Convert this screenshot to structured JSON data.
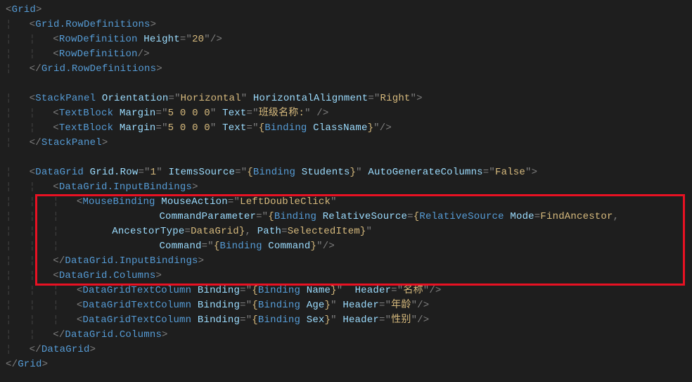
{
  "lines": {
    "l1": {
      "g": "",
      "tokens": [
        {
          "c": "br",
          "t": "<"
        },
        {
          "c": "el",
          "t": "Grid"
        },
        {
          "c": "br",
          "t": ">"
        }
      ]
    },
    "l2": {
      "g": "¦   ",
      "tokens": [
        {
          "c": "br",
          "t": "<"
        },
        {
          "c": "el",
          "t": "Grid.RowDefinitions"
        },
        {
          "c": "br",
          "t": ">"
        }
      ]
    },
    "l3": {
      "g": "¦   ¦   ",
      "tokens": [
        {
          "c": "br",
          "t": "<"
        },
        {
          "c": "el",
          "t": "RowDefinition"
        },
        {
          "c": "pl",
          "t": " "
        },
        {
          "c": "at",
          "t": "Height"
        },
        {
          "c": "br",
          "t": "=\""
        },
        {
          "c": "str",
          "t": "20"
        },
        {
          "c": "br",
          "t": "\"/>"
        }
      ]
    },
    "l4": {
      "g": "¦   ¦   ",
      "tokens": [
        {
          "c": "br",
          "t": "<"
        },
        {
          "c": "el",
          "t": "RowDefinition"
        },
        {
          "c": "br",
          "t": "/>"
        }
      ]
    },
    "l5": {
      "g": "¦   ",
      "tokens": [
        {
          "c": "br",
          "t": "</"
        },
        {
          "c": "el",
          "t": "Grid.RowDefinitions"
        },
        {
          "c": "br",
          "t": ">"
        }
      ]
    },
    "l6": {
      "g": "",
      "tokens": []
    },
    "l7": {
      "g": "¦   ",
      "tokens": [
        {
          "c": "br",
          "t": "<"
        },
        {
          "c": "el",
          "t": "StackPanel"
        },
        {
          "c": "pl",
          "t": " "
        },
        {
          "c": "at",
          "t": "Orientation"
        },
        {
          "c": "br",
          "t": "=\""
        },
        {
          "c": "str",
          "t": "Horizontal"
        },
        {
          "c": "br",
          "t": "\" "
        },
        {
          "c": "at",
          "t": "HorizontalAlignment"
        },
        {
          "c": "br",
          "t": "=\""
        },
        {
          "c": "str",
          "t": "Right"
        },
        {
          "c": "br",
          "t": "\">"
        }
      ]
    },
    "l8": {
      "g": "¦   ¦   ",
      "tokens": [
        {
          "c": "br",
          "t": "<"
        },
        {
          "c": "el",
          "t": "TextBlock"
        },
        {
          "c": "pl",
          "t": " "
        },
        {
          "c": "at",
          "t": "Margin"
        },
        {
          "c": "br",
          "t": "=\""
        },
        {
          "c": "str",
          "t": "5 0 0 0"
        },
        {
          "c": "br",
          "t": "\" "
        },
        {
          "c": "at",
          "t": "Text"
        },
        {
          "c": "br",
          "t": "=\""
        },
        {
          "c": "str",
          "t": "班级名称:"
        },
        {
          "c": "br",
          "t": "\" />"
        }
      ]
    },
    "l9": {
      "g": "¦   ¦   ",
      "tokens": [
        {
          "c": "br",
          "t": "<"
        },
        {
          "c": "el",
          "t": "TextBlock"
        },
        {
          "c": "pl",
          "t": " "
        },
        {
          "c": "at",
          "t": "Margin"
        },
        {
          "c": "br",
          "t": "=\""
        },
        {
          "c": "str",
          "t": "5 0 0 0"
        },
        {
          "c": "br",
          "t": "\" "
        },
        {
          "c": "at",
          "t": "Text"
        },
        {
          "c": "br",
          "t": "=\""
        },
        {
          "c": "str",
          "t": "{"
        },
        {
          "c": "kw",
          "t": "Binding"
        },
        {
          "c": "pl",
          "t": " "
        },
        {
          "c": "at",
          "t": "ClassName"
        },
        {
          "c": "str",
          "t": "}"
        },
        {
          "c": "br",
          "t": "\"/>"
        }
      ]
    },
    "l10": {
      "g": "¦   ",
      "tokens": [
        {
          "c": "br",
          "t": "</"
        },
        {
          "c": "el",
          "t": "StackPanel"
        },
        {
          "c": "br",
          "t": ">"
        }
      ]
    },
    "l11": {
      "g": "",
      "tokens": []
    },
    "l12": {
      "g": "¦   ",
      "tokens": [
        {
          "c": "br",
          "t": "<"
        },
        {
          "c": "el",
          "t": "DataGrid"
        },
        {
          "c": "pl",
          "t": " "
        },
        {
          "c": "at",
          "t": "Grid.Row"
        },
        {
          "c": "br",
          "t": "=\""
        },
        {
          "c": "str",
          "t": "1"
        },
        {
          "c": "br",
          "t": "\" "
        },
        {
          "c": "at",
          "t": "ItemsSource"
        },
        {
          "c": "br",
          "t": "=\""
        },
        {
          "c": "str",
          "t": "{"
        },
        {
          "c": "kw",
          "t": "Binding"
        },
        {
          "c": "pl",
          "t": " "
        },
        {
          "c": "at",
          "t": "Students"
        },
        {
          "c": "str",
          "t": "}"
        },
        {
          "c": "br",
          "t": "\" "
        },
        {
          "c": "at",
          "t": "AutoGenerateColumns"
        },
        {
          "c": "br",
          "t": "=\""
        },
        {
          "c": "str",
          "t": "False"
        },
        {
          "c": "br",
          "t": "\">"
        }
      ]
    },
    "l13": {
      "g": "¦   ¦   ",
      "tokens": [
        {
          "c": "br",
          "t": "<"
        },
        {
          "c": "el",
          "t": "DataGrid.InputBindings"
        },
        {
          "c": "br",
          "t": ">"
        }
      ]
    },
    "l14": {
      "g": "¦   ¦   ¦   ",
      "tokens": [
        {
          "c": "br",
          "t": "<"
        },
        {
          "c": "el",
          "t": "MouseBinding"
        },
        {
          "c": "pl",
          "t": " "
        },
        {
          "c": "at",
          "t": "MouseAction"
        },
        {
          "c": "br",
          "t": "=\""
        },
        {
          "c": "str",
          "t": "LeftDoubleClick"
        },
        {
          "c": "br",
          "t": "\""
        }
      ]
    },
    "l15": {
      "g": "¦   ¦   ¦                 ",
      "tokens": [
        {
          "c": "at",
          "t": "CommandParameter"
        },
        {
          "c": "br",
          "t": "=\""
        },
        {
          "c": "str",
          "t": "{"
        },
        {
          "c": "kw",
          "t": "Binding"
        },
        {
          "c": "pl",
          "t": " "
        },
        {
          "c": "at",
          "t": "RelativeSource"
        },
        {
          "c": "br",
          "t": "="
        },
        {
          "c": "str",
          "t": "{"
        },
        {
          "c": "kw",
          "t": "RelativeSource"
        },
        {
          "c": "pl",
          "t": " "
        },
        {
          "c": "at",
          "t": "Mode"
        },
        {
          "c": "br",
          "t": "="
        },
        {
          "c": "str",
          "t": "FindAncestor"
        },
        {
          "c": "br",
          "t": ","
        }
      ]
    },
    "l16": {
      "g": "¦   ¦   ¦         ",
      "tokens": [
        {
          "c": "at",
          "t": "AncestorType"
        },
        {
          "c": "br",
          "t": "="
        },
        {
          "c": "str",
          "t": "DataGrid}"
        },
        {
          "c": "br",
          "t": ", "
        },
        {
          "c": "at",
          "t": "Path"
        },
        {
          "c": "br",
          "t": "="
        },
        {
          "c": "str",
          "t": "SelectedItem}"
        },
        {
          "c": "br",
          "t": "\""
        }
      ]
    },
    "l17": {
      "g": "¦   ¦   ¦                 ",
      "tokens": [
        {
          "c": "at",
          "t": "Command"
        },
        {
          "c": "br",
          "t": "=\""
        },
        {
          "c": "str",
          "t": "{"
        },
        {
          "c": "kw",
          "t": "Binding"
        },
        {
          "c": "pl",
          "t": " "
        },
        {
          "c": "at",
          "t": "Command"
        },
        {
          "c": "str",
          "t": "}"
        },
        {
          "c": "br",
          "t": "\"/>"
        }
      ]
    },
    "l18": {
      "g": "¦   ¦   ",
      "tokens": [
        {
          "c": "br",
          "t": "</"
        },
        {
          "c": "el",
          "t": "DataGrid.InputBindings"
        },
        {
          "c": "br",
          "t": ">"
        }
      ]
    },
    "l19": {
      "g": "¦   ¦   ",
      "tokens": [
        {
          "c": "br",
          "t": "<"
        },
        {
          "c": "el",
          "t": "DataGrid.Columns"
        },
        {
          "c": "br",
          "t": ">"
        }
      ]
    },
    "l20": {
      "g": "¦   ¦   ¦   ",
      "tokens": [
        {
          "c": "br",
          "t": "<"
        },
        {
          "c": "el",
          "t": "DataGridTextColumn"
        },
        {
          "c": "pl",
          "t": " "
        },
        {
          "c": "at",
          "t": "Binding"
        },
        {
          "c": "br",
          "t": "=\""
        },
        {
          "c": "str",
          "t": "{"
        },
        {
          "c": "kw",
          "t": "Binding"
        },
        {
          "c": "pl",
          "t": " "
        },
        {
          "c": "at",
          "t": "Name"
        },
        {
          "c": "str",
          "t": "}"
        },
        {
          "c": "br",
          "t": "\"  "
        },
        {
          "c": "at",
          "t": "Header"
        },
        {
          "c": "br",
          "t": "=\""
        },
        {
          "c": "str",
          "t": "名称"
        },
        {
          "c": "br",
          "t": "\"/>"
        }
      ]
    },
    "l21": {
      "g": "¦   ¦   ¦   ",
      "tokens": [
        {
          "c": "br",
          "t": "<"
        },
        {
          "c": "el",
          "t": "DataGridTextColumn"
        },
        {
          "c": "pl",
          "t": " "
        },
        {
          "c": "at",
          "t": "Binding"
        },
        {
          "c": "br",
          "t": "=\""
        },
        {
          "c": "str",
          "t": "{"
        },
        {
          "c": "kw",
          "t": "Binding"
        },
        {
          "c": "pl",
          "t": " "
        },
        {
          "c": "at",
          "t": "Age"
        },
        {
          "c": "str",
          "t": "}"
        },
        {
          "c": "br",
          "t": "\" "
        },
        {
          "c": "at",
          "t": "Header"
        },
        {
          "c": "br",
          "t": "=\""
        },
        {
          "c": "str",
          "t": "年龄"
        },
        {
          "c": "br",
          "t": "\"/>"
        }
      ]
    },
    "l22": {
      "g": "¦   ¦   ¦   ",
      "tokens": [
        {
          "c": "br",
          "t": "<"
        },
        {
          "c": "el",
          "t": "DataGridTextColumn"
        },
        {
          "c": "pl",
          "t": " "
        },
        {
          "c": "at",
          "t": "Binding"
        },
        {
          "c": "br",
          "t": "=\""
        },
        {
          "c": "str",
          "t": "{"
        },
        {
          "c": "kw",
          "t": "Binding"
        },
        {
          "c": "pl",
          "t": " "
        },
        {
          "c": "at",
          "t": "Sex"
        },
        {
          "c": "str",
          "t": "}"
        },
        {
          "c": "br",
          "t": "\" "
        },
        {
          "c": "at",
          "t": "Header"
        },
        {
          "c": "br",
          "t": "=\""
        },
        {
          "c": "str",
          "t": "性别"
        },
        {
          "c": "br",
          "t": "\"/>"
        }
      ]
    },
    "l23": {
      "g": "¦   ¦   ",
      "tokens": [
        {
          "c": "br",
          "t": "</"
        },
        {
          "c": "el",
          "t": "DataGrid.Columns"
        },
        {
          "c": "br",
          "t": ">"
        }
      ]
    },
    "l24": {
      "g": "¦   ",
      "tokens": [
        {
          "c": "br",
          "t": "</"
        },
        {
          "c": "el",
          "t": "DataGrid"
        },
        {
          "c": "br",
          "t": ">"
        }
      ]
    },
    "l25": {
      "g": "",
      "tokens": [
        {
          "c": "br",
          "t": "</"
        },
        {
          "c": "el",
          "t": "Grid"
        },
        {
          "c": "br",
          "t": ">"
        }
      ]
    }
  },
  "line_order": [
    "l1",
    "l2",
    "l3",
    "l4",
    "l5",
    "l6",
    "l7",
    "l8",
    "l9",
    "l10",
    "l11",
    "l12",
    "l13",
    "l14",
    "l15",
    "l16",
    "l17",
    "l18",
    "l19",
    "l20",
    "l21",
    "l22",
    "l23",
    "l24",
    "l25"
  ]
}
